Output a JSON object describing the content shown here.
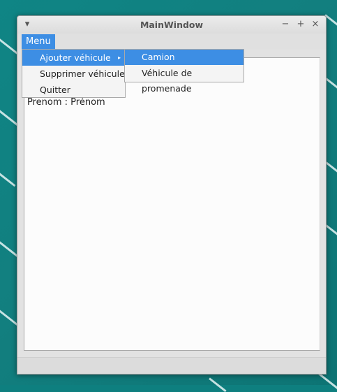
{
  "window": {
    "title": "MainWindow",
    "controls": {
      "menu_glyph": "▾",
      "minimize": "−",
      "maximize": "+",
      "close": "×"
    }
  },
  "menubar": {
    "menu_label": "Menu"
  },
  "menu": {
    "items": [
      {
        "label": "Ajouter véhicule",
        "has_submenu": true,
        "submenu_glyph": "▸"
      },
      {
        "label": "Supprimer véhicule"
      },
      {
        "label": "Quitter"
      }
    ],
    "submenu": {
      "items": [
        {
          "label": "Camion"
        },
        {
          "label": "Véhicule de promenade"
        }
      ]
    }
  },
  "content": {
    "info_text": "Prenom  : Prénom"
  },
  "colors": {
    "accent": "#3d8ee4",
    "desktop": "#0f8585"
  }
}
